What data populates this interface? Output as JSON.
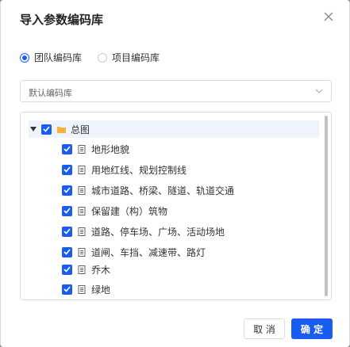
{
  "dialog": {
    "title": "导入参数编码库",
    "close_icon": "close-icon"
  },
  "scope": {
    "options": [
      {
        "label": "团队编码库",
        "checked": true
      },
      {
        "label": "项目编码库",
        "checked": false
      }
    ]
  },
  "library_select": {
    "value": "默认编码库"
  },
  "tree": {
    "root": {
      "label": "总图",
      "checked": true,
      "expanded": true,
      "icon": "folder-icon"
    },
    "items": [
      {
        "label": "地形地貌",
        "checked": true,
        "icon": "document-icon"
      },
      {
        "label": "用地红线、规划控制线",
        "checked": true,
        "icon": "document-icon"
      },
      {
        "label": "城市道路、桥梁、隧道、轨道交通",
        "checked": true,
        "icon": "document-icon"
      },
      {
        "label": "保留建（构）筑物",
        "checked": true,
        "icon": "document-icon"
      },
      {
        "label": "道路、停车场、广场、活动场地",
        "checked": true,
        "icon": "document-icon"
      },
      {
        "label": "道闸、车挡、减速带、路灯",
        "checked": true,
        "icon": "document-icon"
      },
      {
        "label": "乔木",
        "checked": true,
        "icon": "document-icon"
      },
      {
        "label": "绿地",
        "checked": true,
        "icon": "document-icon"
      }
    ]
  },
  "footer": {
    "cancel_label": "取 消",
    "ok_label": "确 定"
  },
  "colors": {
    "accent": "#1a5cf0",
    "folder": "#f5b041"
  }
}
